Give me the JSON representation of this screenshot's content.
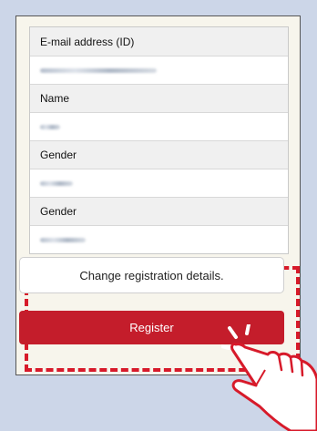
{
  "form": {
    "rows": [
      {
        "label": "E-mail address (ID)",
        "value_blurred": true
      },
      {
        "label": "Name",
        "value_blurred": true
      },
      {
        "label": "Gender",
        "value_blurred": true
      },
      {
        "label": "Gender",
        "value_blurred": true
      }
    ]
  },
  "buttons": {
    "change_label": "Change registration details.",
    "register_label": "Register"
  },
  "colors": {
    "background": "#ccd6e8",
    "card": "#f7f5ec",
    "accent_red": "#c41d2b",
    "highlight_dash": "#d71a2a"
  },
  "icons": {
    "pointer": "pointing-hand-icon"
  }
}
